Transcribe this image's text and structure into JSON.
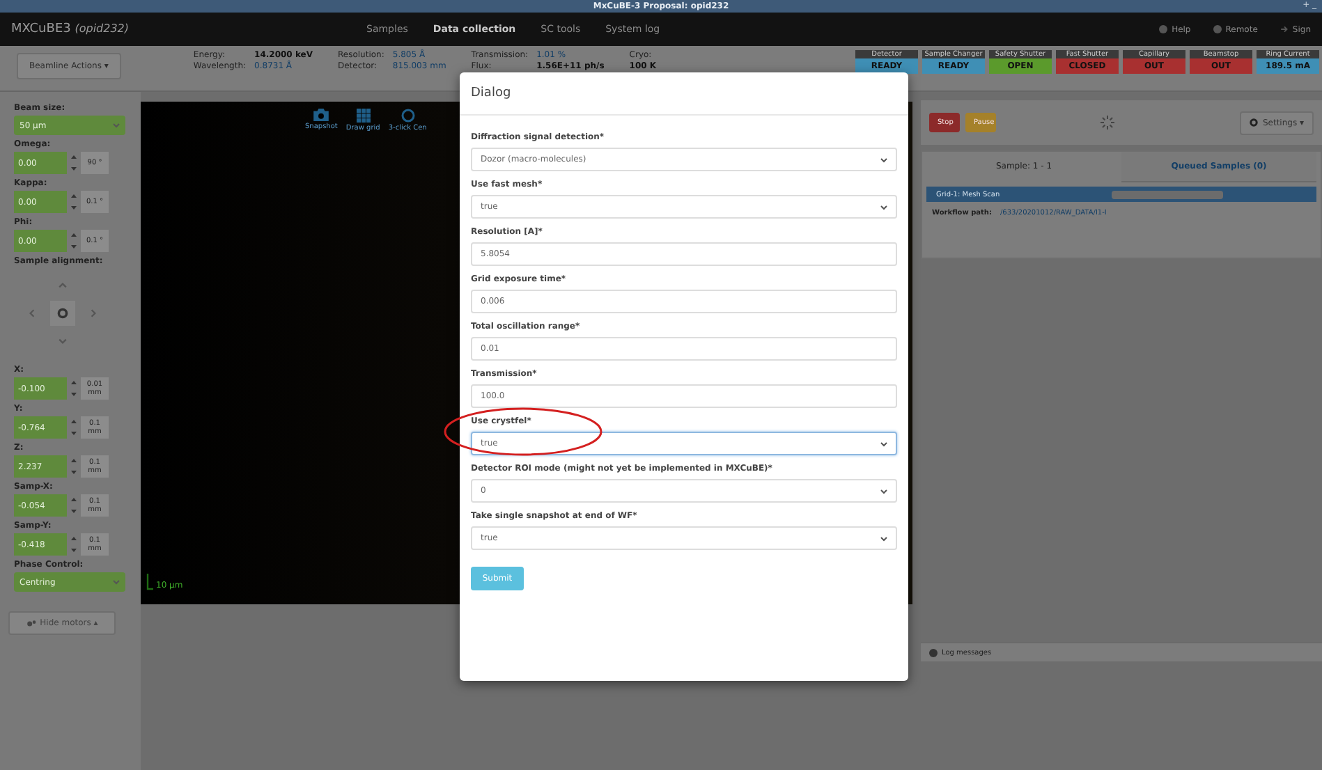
{
  "window": {
    "title": "MxCuBE-3 Proposal: opid232",
    "controls": [
      "+",
      "_"
    ]
  },
  "navbar": {
    "brand": "MXCuBE3",
    "brand_user": "(opid232)",
    "items": [
      {
        "label": "Samples",
        "selected": false
      },
      {
        "label": "Data collection",
        "selected": true
      },
      {
        "label": "SC tools",
        "selected": false
      },
      {
        "label": "System log",
        "selected": false
      }
    ],
    "right": [
      {
        "label": "Help"
      },
      {
        "label": "Remote"
      },
      {
        "label": "Sign"
      }
    ]
  },
  "beamline": {
    "actions_button": "Beamline Actions ▾",
    "info": [
      {
        "label": "Energy:",
        "value": "14.2000 keV",
        "link": false
      },
      {
        "label": "Wavelength:",
        "value": "0.8731 Å",
        "link": true
      },
      {
        "label": "Resolution:",
        "value": "5.805 Å",
        "link": true
      },
      {
        "label": "Detector:",
        "value": "815.003 mm",
        "link": true
      },
      {
        "label": "Transmission:",
        "value": "1.01 %",
        "link": true
      },
      {
        "label": "Flux:",
        "value": "1.56E+11 ph/s",
        "link": false
      },
      {
        "label": "Cryo:",
        "value": "100 K",
        "link": false
      }
    ],
    "status": [
      {
        "label": "Detector",
        "state": "READY",
        "color": "#3f8fb5"
      },
      {
        "label": "Sample Changer",
        "state": "READY",
        "color": "#3f8fb5"
      },
      {
        "label": "Safety Shutter",
        "state": "OPEN",
        "color": "#5b9a2c"
      },
      {
        "label": "Fast Shutter",
        "state": "CLOSED",
        "color": "#a83030"
      },
      {
        "label": "Capillary",
        "state": "OUT",
        "color": "#a83030"
      },
      {
        "label": "Beamstop",
        "state": "OUT",
        "color": "#a83030"
      },
      {
        "label": "Ring Current",
        "state": "189.5 mA",
        "color": "#3f8fb5"
      }
    ]
  },
  "sidebar": {
    "beam_size": {
      "label": "Beam size:",
      "value": "50 µm"
    },
    "motors_top": [
      {
        "label": "Omega:",
        "value": "0.00",
        "step": "90 °"
      },
      {
        "label": "Kappa:",
        "value": "0.00",
        "step": "0.1 °"
      },
      {
        "label": "Phi:",
        "value": "0.00",
        "step": "0.1 °"
      }
    ],
    "alignment_label": "Sample alignment:",
    "motors": [
      {
        "label": "X:",
        "value": "-0.100",
        "step": "0.01",
        "unit": "mm"
      },
      {
        "label": "Y:",
        "value": "-0.764",
        "step": "0.1",
        "unit": "mm"
      },
      {
        "label": "Z:",
        "value": "2.237",
        "step": "0.1",
        "unit": "mm"
      },
      {
        "label": "Samp-X:",
        "value": "-0.054",
        "step": "0.1",
        "unit": "mm"
      },
      {
        "label": "Samp-Y:",
        "value": "-0.418",
        "step": "0.1",
        "unit": "mm"
      }
    ],
    "phase": {
      "label": "Phase Control:",
      "value": "Centring"
    },
    "hide_motors": "Hide motors ▴"
  },
  "video": {
    "tools": [
      {
        "label": "Snapshot"
      },
      {
        "label": "Draw grid"
      },
      {
        "label": "3-click Cen"
      }
    ],
    "scale": "10 µm"
  },
  "right_panel": {
    "stop": "Stop",
    "pause": "Pause",
    "settings": "Settings ▾",
    "tabs": [
      {
        "label": "Sample: 1 - 1",
        "selected": true
      },
      {
        "label": "Queued Samples (0)",
        "selected": false
      }
    ],
    "queue_item": {
      "label": "Grid-1: Mesh Scan",
      "level": 0
    },
    "workflow_label": "Workflow path:",
    "workflow_path": "/633/20201012/RAW_DATA/I1-I",
    "log_title": "Log messages"
  },
  "dialog": {
    "title": "Dialog",
    "fields": [
      {
        "label": "Diffraction signal detection*",
        "value": "Dozor (macro-molecules)",
        "kind": "select",
        "focused": false,
        "annotated": false
      },
      {
        "label": "Use fast mesh*",
        "value": "true",
        "kind": "select",
        "focused": false,
        "annotated": false
      },
      {
        "label": "Resolution [A]*",
        "value": "5.8054",
        "kind": "input",
        "focused": false,
        "annotated": false
      },
      {
        "label": "Grid exposure time*",
        "value": "0.006",
        "kind": "input",
        "focused": false,
        "annotated": false
      },
      {
        "label": "Total oscillation range*",
        "value": "0.01",
        "kind": "input",
        "focused": false,
        "annotated": false
      },
      {
        "label": "Transmission*",
        "value": "100.0",
        "kind": "input",
        "focused": false,
        "annotated": false
      },
      {
        "label": "Use crystfel*",
        "value": "true",
        "kind": "select",
        "focused": true,
        "annotated": true
      },
      {
        "label": "Detector ROI mode (might not yet be implemented in MXCuBE)*",
        "value": "0",
        "kind": "select",
        "focused": false,
        "annotated": false
      },
      {
        "label": "Take single snapshot at end of WF*",
        "value": "true",
        "kind": "select",
        "focused": false,
        "annotated": false
      }
    ],
    "submit": "Submit"
  }
}
